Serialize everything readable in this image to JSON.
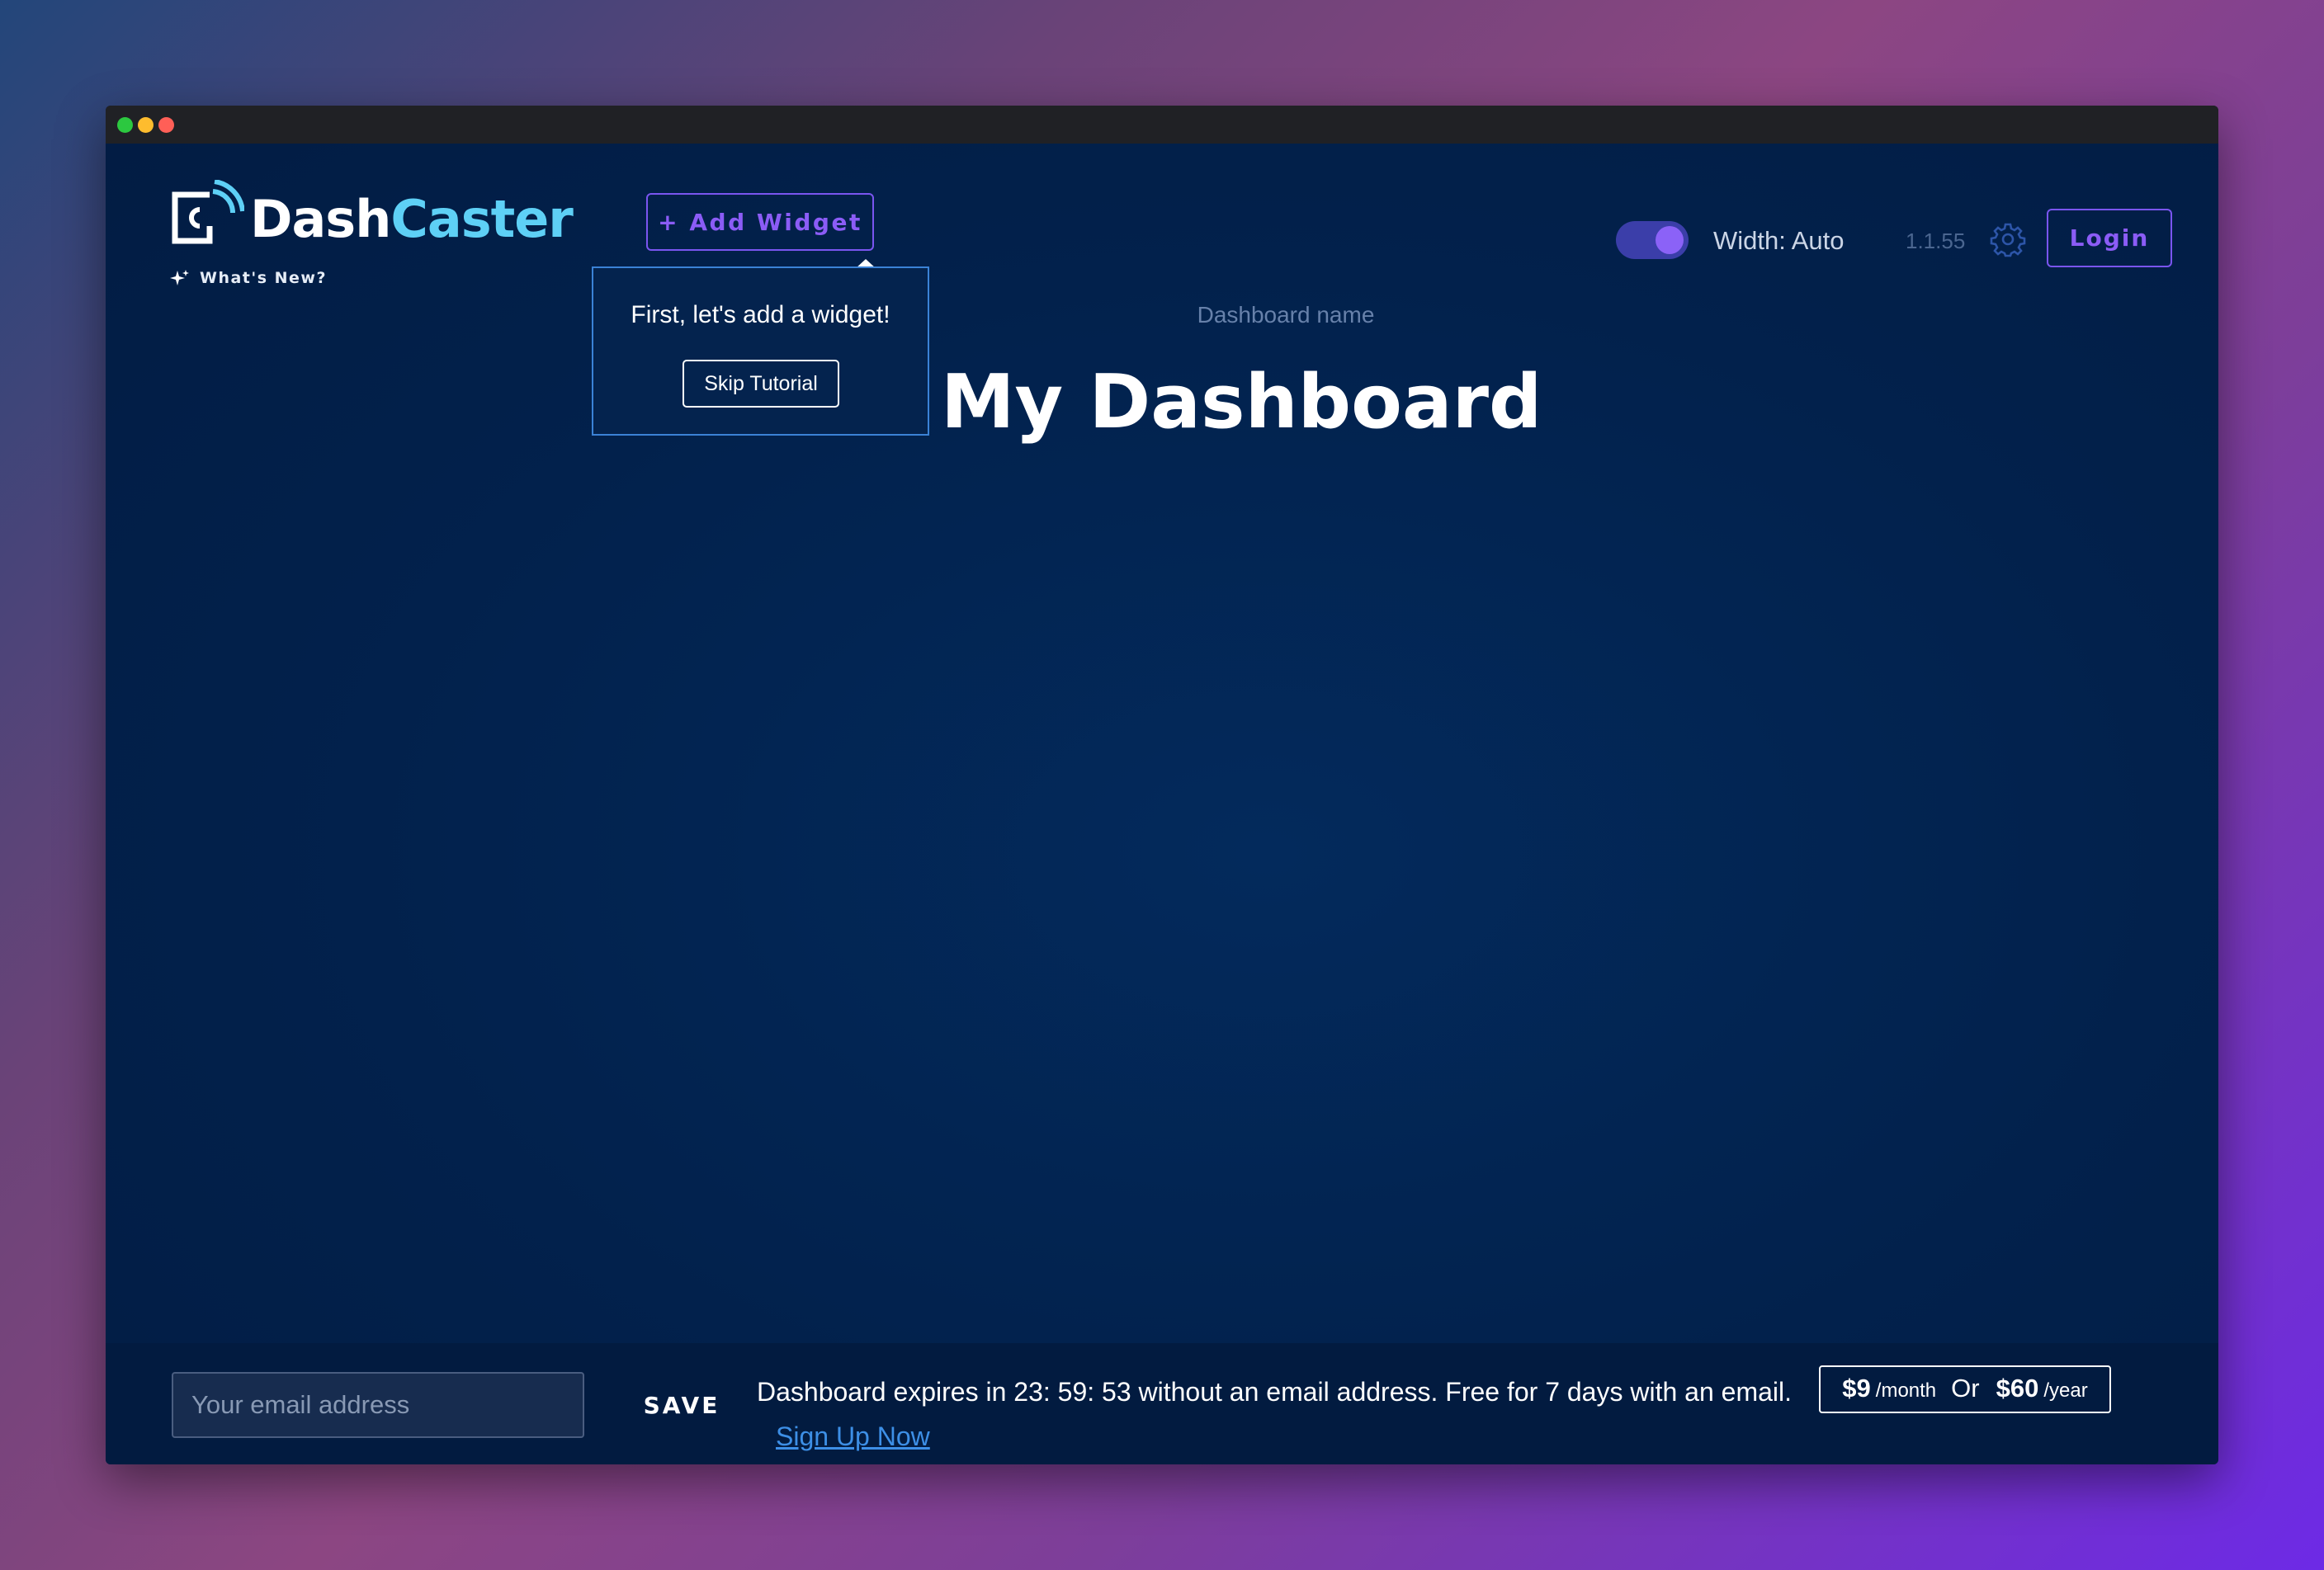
{
  "app": {
    "logo_part1": "Dash",
    "logo_part2": "Caster",
    "whats_new": "What's New?"
  },
  "toolbar": {
    "add_widget_label": "+ Add Widget",
    "width_label": "Width: Auto",
    "width_toggle_on": true,
    "version": "1.1.55",
    "login_label": "Login"
  },
  "tutorial": {
    "message": "First, let's add a widget!",
    "skip_label": "Skip Tutorial"
  },
  "dashboard": {
    "name_label": "Dashboard name",
    "title": "My Dashboard"
  },
  "footer": {
    "email_placeholder": "Your email address",
    "save_label": "SAVE",
    "expire_message": "Dashboard expires in 23: 59: 53 without an email address. Free for 7 days with an email.",
    "signup_label": "Sign Up Now",
    "pricing": {
      "monthly_price": "$9",
      "monthly_unit": "/month",
      "separator": "Or",
      "yearly_price": "$60",
      "yearly_unit": "/year"
    }
  },
  "colors": {
    "accent": "#8b5cf6",
    "logo_secondary": "#5ed0f6",
    "background": "#02214c",
    "link": "#3d8fe6"
  }
}
